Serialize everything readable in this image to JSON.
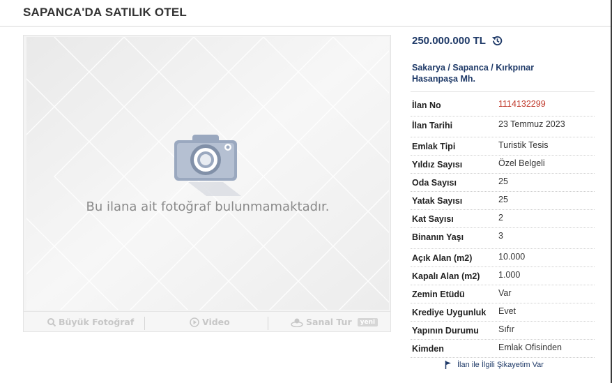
{
  "listing": {
    "title": "SAPANCA'DA SATILIK OTEL",
    "price": "250.000.000 TL",
    "location": {
      "line1": "Sakarya / Sapanca / Kırkpınar",
      "line2": "Hasanpaşa Mh."
    }
  },
  "photo": {
    "no_photo_text": "Bu ilana ait fotoğraf bulunmamaktadır.",
    "buttons": {
      "large_photo": "Büyük Fotoğraf",
      "video": "Video",
      "virtual_tour": "Sanal Tur",
      "new_badge": "yeni"
    }
  },
  "details": [
    {
      "label": "İlan No",
      "value": "1114132299"
    },
    {
      "label": "İlan Tarihi",
      "value": "23 Temmuz 2023"
    },
    {
      "label": "Emlak Tipi",
      "value": "Turistik Tesis"
    },
    {
      "label": "Yıldız Sayısı",
      "value": "Özel Belgeli"
    },
    {
      "label": "Oda Sayısı",
      "value": "25"
    },
    {
      "label": "Yatak Sayısı",
      "value": "25"
    },
    {
      "label": "Kat Sayısı",
      "value": "2"
    },
    {
      "label": "Binanın Yaşı",
      "value": "3"
    },
    {
      "label": "Açık Alan (m2)",
      "value": "10.000"
    },
    {
      "label": "Kapalı Alan (m2)",
      "value": "1.000"
    },
    {
      "label": "Zemin Etüdü",
      "value": "Var"
    },
    {
      "label": "Krediye Uygunluk",
      "value": "Evet"
    },
    {
      "label": "Yapının Durumu",
      "value": "Sıfır"
    },
    {
      "label": "Kimden",
      "value": "Emlak Ofisinden"
    }
  ],
  "complaint_link": "İlan ile İlgili Şikayetim Var",
  "colors": {
    "accent": "#1f3a68",
    "listing_no": "#c0392b"
  }
}
